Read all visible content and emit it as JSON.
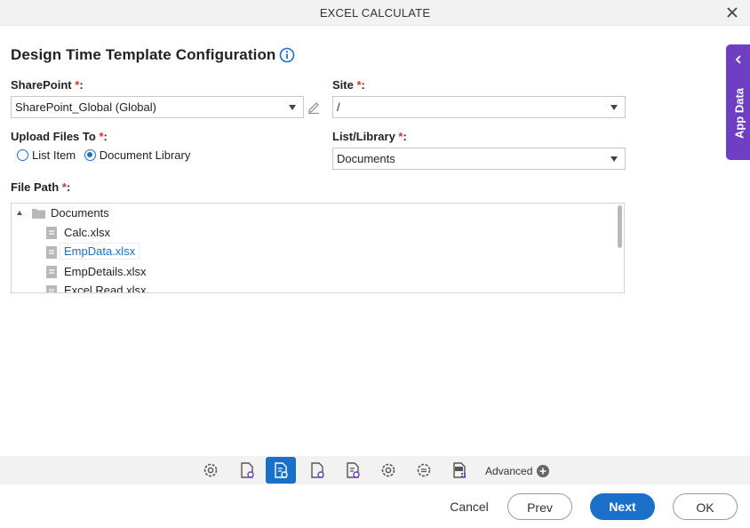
{
  "window": {
    "title": "EXCEL CALCULATE"
  },
  "heading": "Design Time Template Configuration",
  "sharepoint": {
    "label": "SharePoint",
    "value": "SharePoint_Global (Global)"
  },
  "site": {
    "label": "Site",
    "value": "/"
  },
  "upload": {
    "label": "Upload Files To",
    "options": [
      {
        "label": "List Item",
        "selected": false
      },
      {
        "label": "Document Library",
        "selected": true
      }
    ]
  },
  "list_library": {
    "label": "List/Library",
    "value": "Documents"
  },
  "file_path": {
    "label": "File Path",
    "root": "Documents",
    "files": [
      "Calc.xlsx",
      "EmpData.xlsx",
      "EmpDetails.xlsx",
      "Excel Read.xlsx"
    ],
    "selected_file": "EmpData.xlsx"
  },
  "side_panel": {
    "label": "App Data"
  },
  "toolbar": {
    "icons": [
      "gear-icon",
      "document-gear-icon",
      "document-list-gear-icon",
      "document-gear-icon",
      "document-list-gear-icon",
      "gear-icon",
      "list-gear-icon",
      "xls-file-icon"
    ],
    "advanced_label": "Advanced"
  },
  "required_mark": "*",
  "buttons": {
    "cancel": "Cancel",
    "prev": "Prev",
    "next": "Next",
    "ok": "OK"
  },
  "colors": {
    "accent": "#1a6fc9",
    "side_panel": "#6e3fc3",
    "required": "#d9302c"
  }
}
